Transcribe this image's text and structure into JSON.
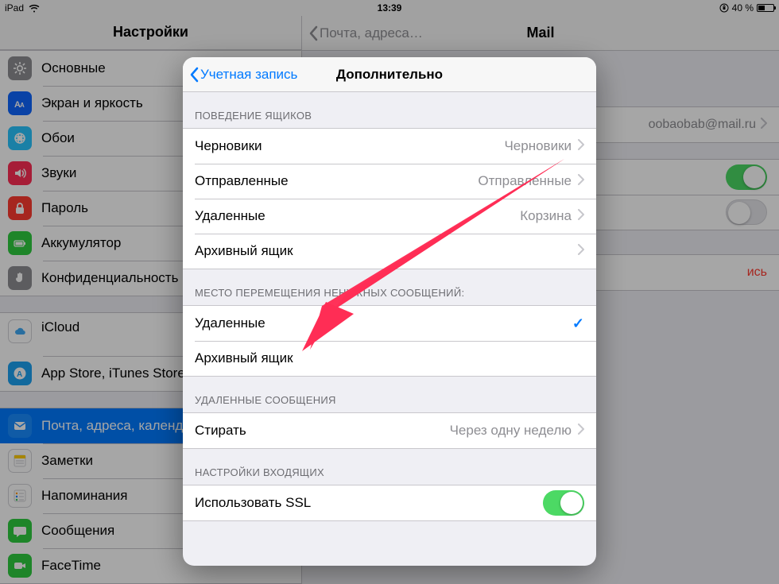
{
  "status": {
    "device": "iPad",
    "time": "13:39",
    "battery_text": "40 %"
  },
  "sidebar": {
    "title": "Настройки",
    "groups": [
      [
        {
          "icon": "gear",
          "bg": "#8e8e93",
          "label": "Основные"
        },
        {
          "icon": "textsize",
          "bg": "#0f66ff",
          "label": "Экран и яркость"
        },
        {
          "icon": "wallpaper",
          "bg": "#29c5ff",
          "label": "Обои"
        },
        {
          "icon": "speaker",
          "bg": "#ff2d55",
          "label": "Звуки"
        },
        {
          "icon": "lock",
          "bg": "#ff3b30",
          "label": "Пароль"
        },
        {
          "icon": "battery",
          "bg": "#2ecc40",
          "label": "Аккумулятор"
        },
        {
          "icon": "hand",
          "bg": "#8e8e93",
          "label": "Конфиденциальность"
        }
      ],
      [
        {
          "icon": "cloud",
          "bg": "#ffffff",
          "label": "iCloud",
          "sub": true
        },
        {
          "icon": "appstore",
          "bg": "#1da1f2",
          "label": "App Store, iTunes Store"
        }
      ],
      [
        {
          "icon": "mail",
          "bg": "#1a8cff",
          "label": "Почта, адреса, календари",
          "selected": true
        },
        {
          "icon": "notes",
          "bg": "#ffffff",
          "label": "Заметки"
        },
        {
          "icon": "reminders",
          "bg": "#ffffff",
          "label": "Напоминания"
        },
        {
          "icon": "messages",
          "bg": "#2ecc40",
          "label": "Сообщения"
        },
        {
          "icon": "facetime",
          "bg": "#2ecc40",
          "label": "FaceTime"
        }
      ]
    ]
  },
  "detail": {
    "back_label": "Почта, адреса…",
    "title": "Mail",
    "account_value": "oobaobab@mail.ru",
    "danger_action": "ись"
  },
  "modal": {
    "back": "Учетная запись",
    "title": "Дополнительно",
    "sec_behavior": "ПОВЕДЕНИЕ ЯЩИКОВ",
    "rows_behavior": [
      {
        "label": "Черновики",
        "value": "Черновики"
      },
      {
        "label": "Отправленные",
        "value": "Отправленные"
      },
      {
        "label": "Удаленные",
        "value": "Корзина"
      },
      {
        "label": "Архивный ящик",
        "value": ""
      }
    ],
    "sec_move": "МЕСТО ПЕРЕМЕЩЕНИЯ НЕНУЖНЫХ СООБЩЕНИЙ:",
    "rows_move": [
      {
        "label": "Удаленные",
        "checked": true
      },
      {
        "label": "Архивный ящик",
        "checked": false
      }
    ],
    "sec_deleted": "УДАЛЕННЫЕ СООБЩЕНИЯ",
    "erase_label": "Стирать",
    "erase_value": "Через одну неделю",
    "sec_incoming": "НАСТРОЙКИ ВХОДЯЩИХ",
    "ssl_label": "Использовать SSL"
  }
}
